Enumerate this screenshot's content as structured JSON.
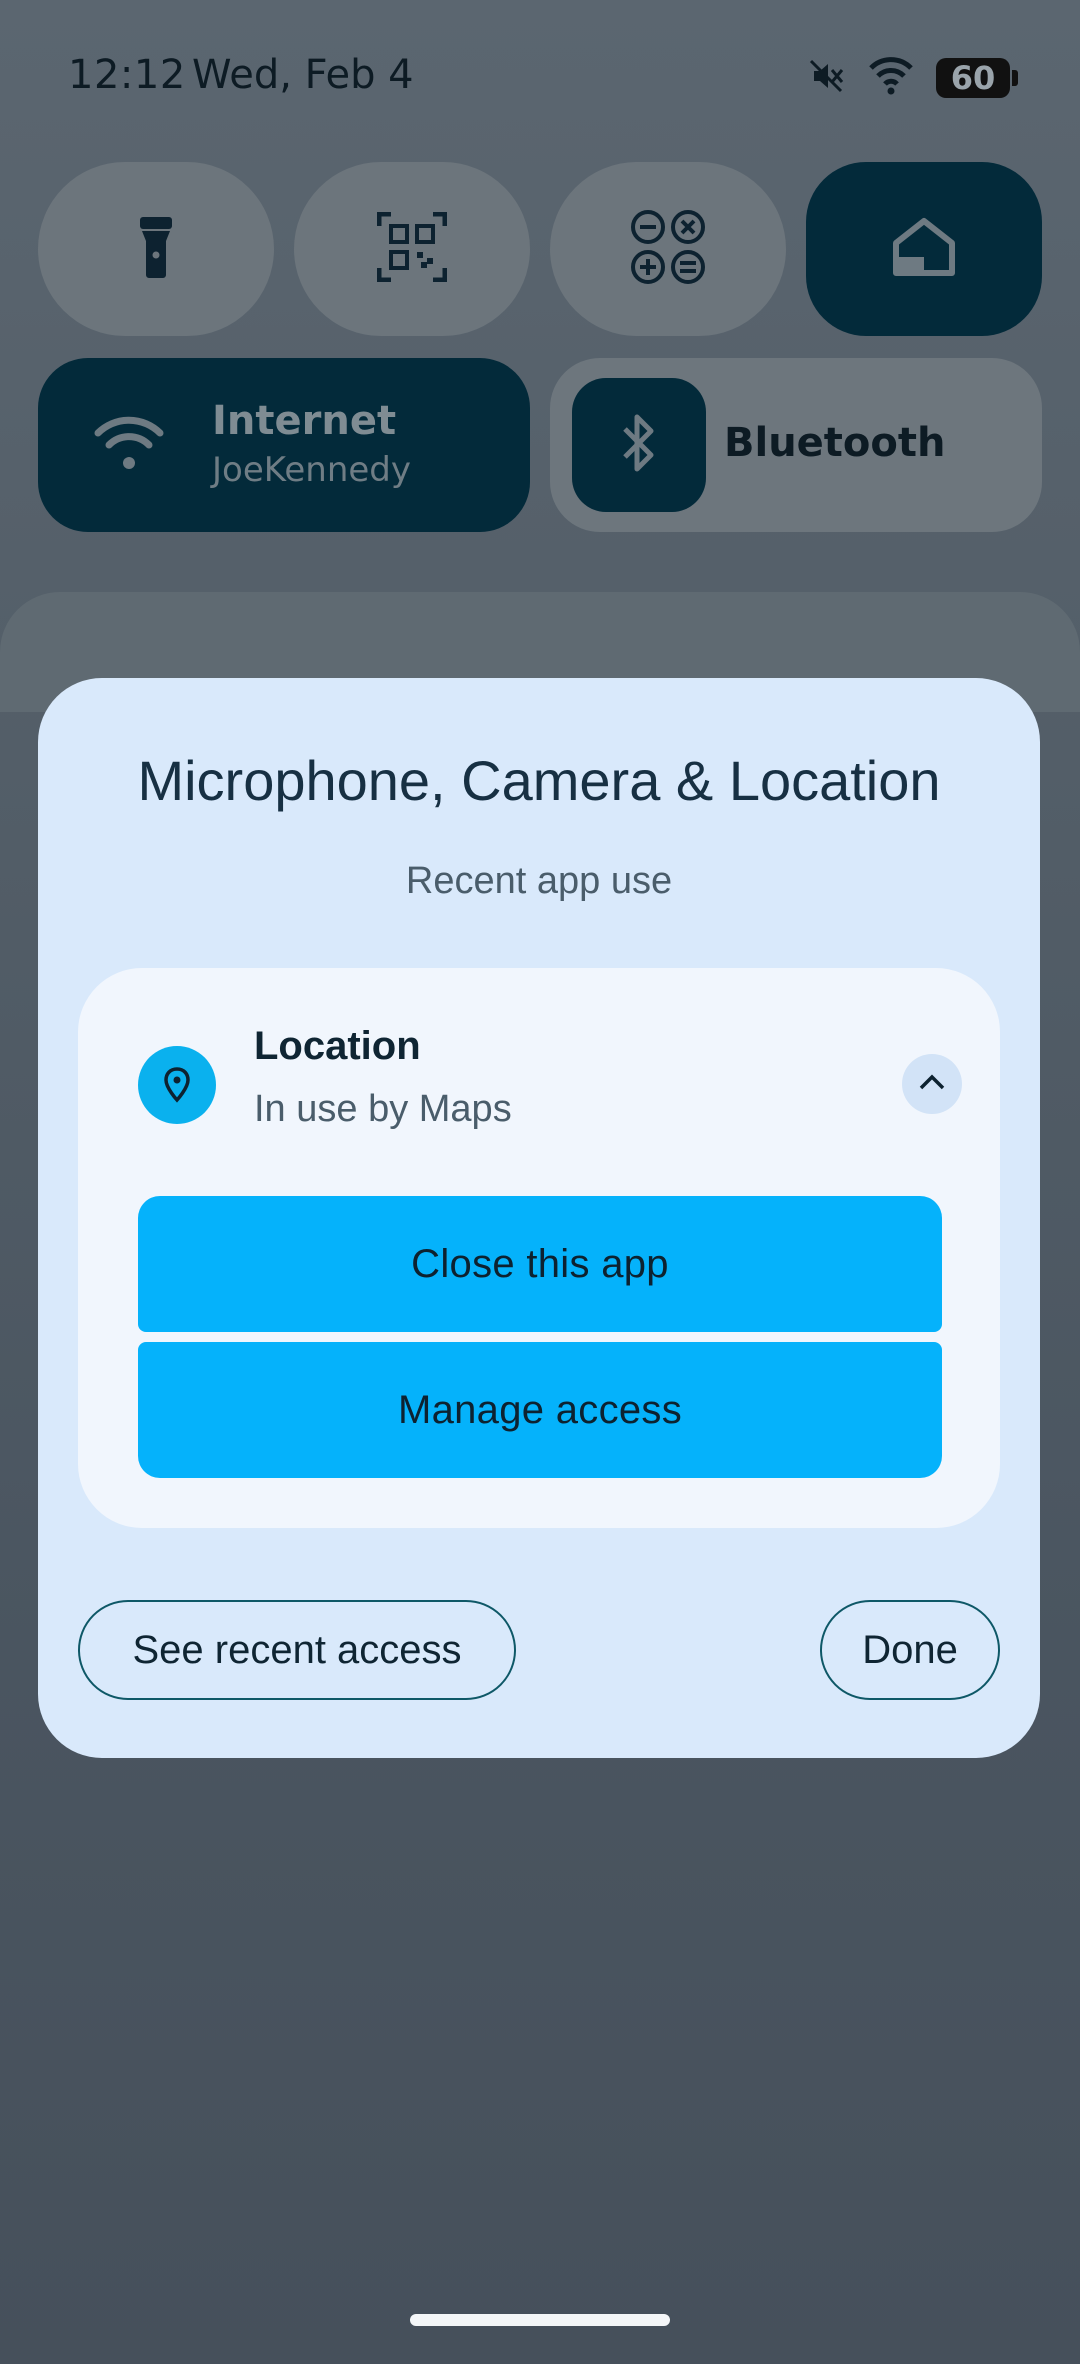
{
  "status_bar": {
    "time": "12:12",
    "date": "Wed, Feb 4",
    "battery": "60",
    "icons": [
      "mute-icon",
      "wifi-icon",
      "battery-icon"
    ]
  },
  "quick_tiles": {
    "row1": [
      {
        "name": "flashlight",
        "icon": "flashlight-icon",
        "active": false
      },
      {
        "name": "qr-scanner",
        "icon": "qr-code-icon",
        "active": false
      },
      {
        "name": "calculator",
        "icon": "calculator-icon",
        "active": false
      },
      {
        "name": "home",
        "icon": "home-icon",
        "active": true
      }
    ],
    "internet": {
      "title": "Internet",
      "subtitle": "JoeKennedy",
      "icon": "wifi-icon",
      "active": true
    },
    "bluetooth": {
      "title": "Bluetooth",
      "icon": "bluetooth-icon",
      "active": false
    }
  },
  "dialog": {
    "title": "Microphone, Camera & Location",
    "subtitle": "Recent app use",
    "item": {
      "title": "Location",
      "subtitle": "In use by Maps",
      "icon": "location-pin-icon",
      "expand_icon": "chevron-up-icon"
    },
    "actions": {
      "close_app": "Close this app",
      "manage_access": "Manage access"
    },
    "footer": {
      "recent": "See recent access",
      "done": "Done"
    }
  },
  "colors": {
    "accent": "#05b2fb",
    "tile_active": "#032a3a",
    "dialog_bg": "#d9e9fb",
    "card_bg": "#f1f6fd"
  }
}
